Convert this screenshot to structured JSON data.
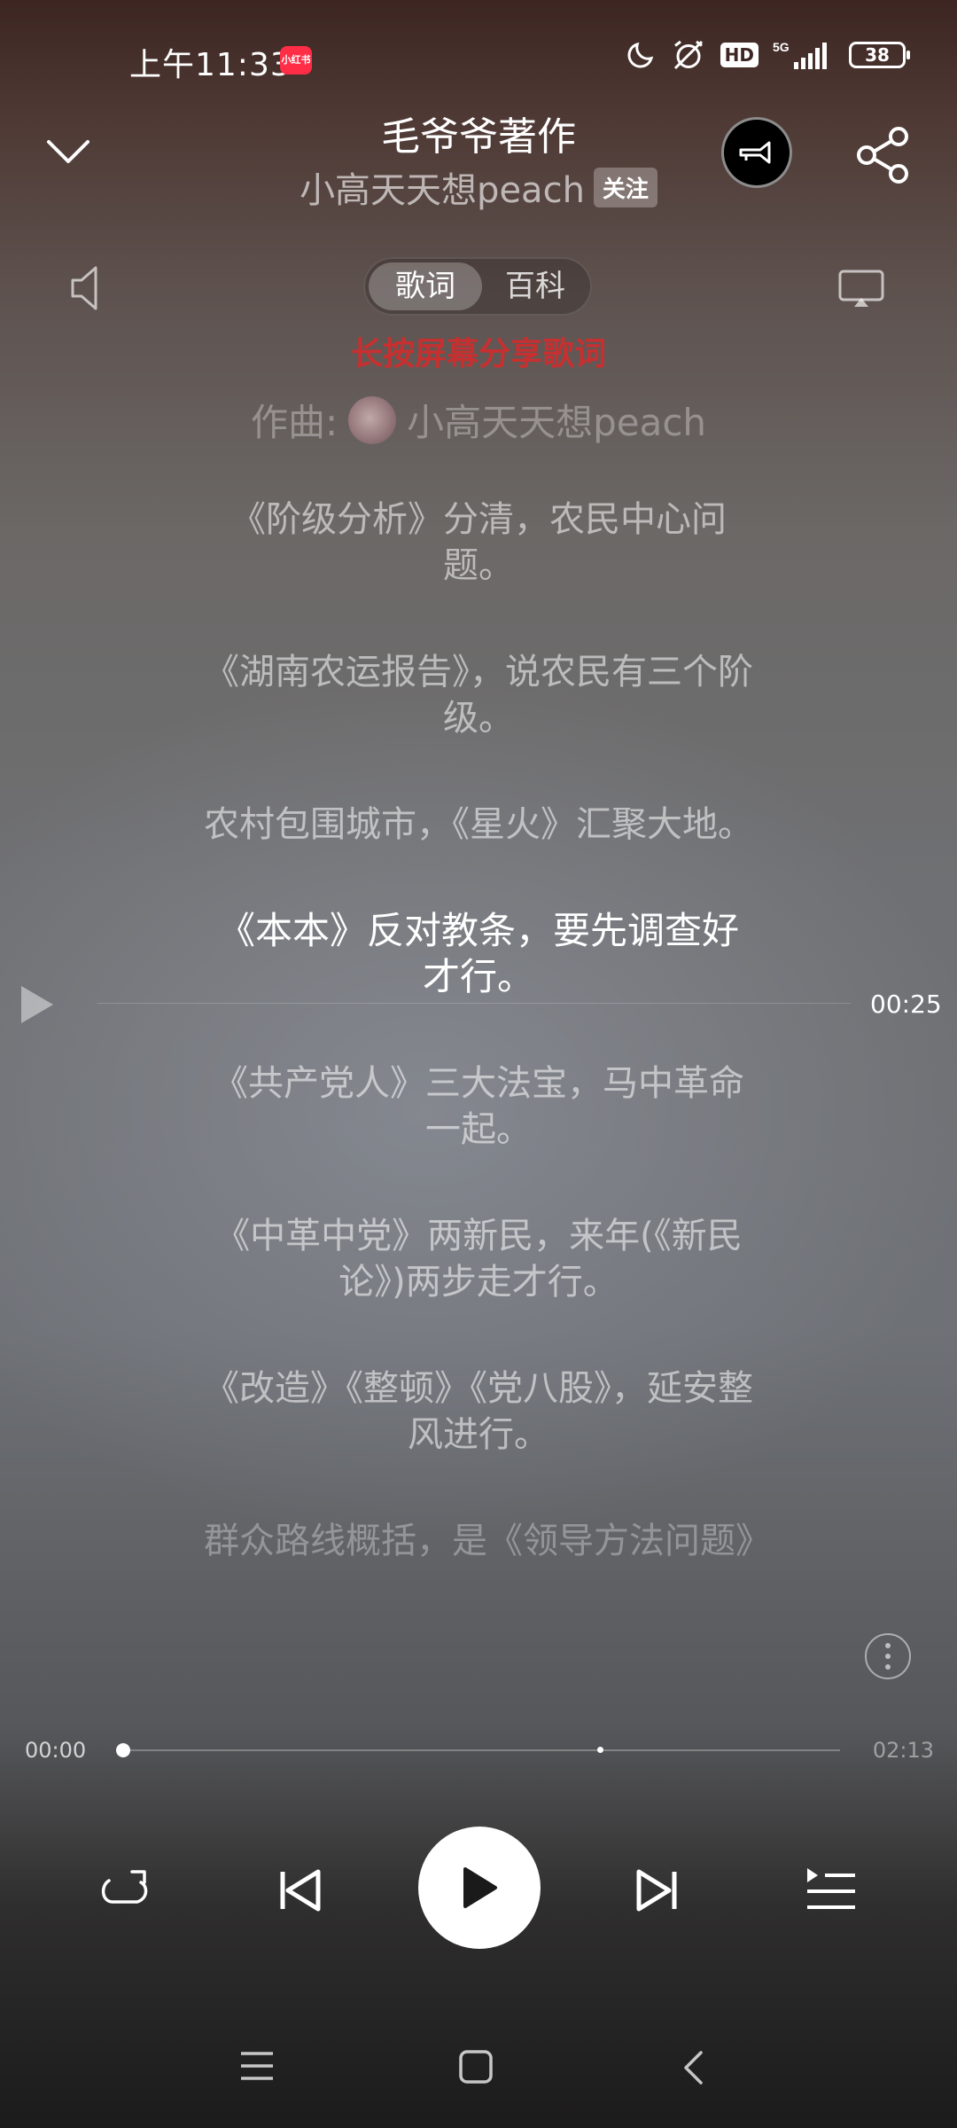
{
  "status_bar": {
    "time": "上午11:33",
    "app_badge": "小红书",
    "hd": "HD",
    "network": "5G",
    "battery": "38"
  },
  "header": {
    "title": "毛爷爷著作",
    "artist": "小高天天想peach",
    "follow_label": "关注"
  },
  "tabs": {
    "lyrics": "歌词",
    "wiki": "百科"
  },
  "hint": "长按屏幕分享歌词",
  "composer": {
    "label": "作曲:",
    "name": "小高天天想peach"
  },
  "lyrics": [
    "《阶级分析》分清，农民中心问题。",
    "《湖南农运报告》，说农民有三个阶级。",
    "农村包围城市，《星火》汇聚大地。",
    "《本本》反对教条，要先调查好才行。",
    "《共产党人》三大法宝，马中革命一起。",
    "《中革中党》两新民，来年(《新民论》)两步走才行。",
    "《改造》《整顿》《党八股》，延安整风进行。",
    "群众路线概括，是《领导方法问题》"
  ],
  "seek_time": "00:25",
  "progress": {
    "current": "00:00",
    "total": "02:13",
    "fraction": 0.0
  },
  "colors": {
    "hint": "#d92a2a",
    "badge": "#ff2d46"
  }
}
